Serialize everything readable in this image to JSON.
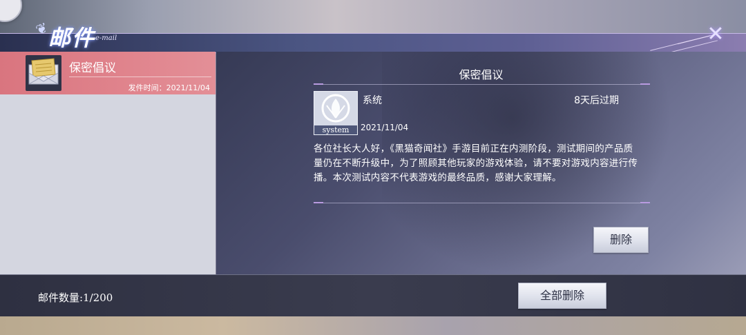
{
  "header": {
    "title": "邮件",
    "subtitle": "e-mail",
    "close_icon": "close-icon"
  },
  "mail_list": {
    "items": [
      {
        "title": "保密倡议",
        "date_text": "发件时间：2021/11/04",
        "icon": "envelope-icon",
        "selected": true
      }
    ]
  },
  "detail": {
    "title": "保密倡议",
    "sender": "系统",
    "avatar_label": "system",
    "expire": "8天后过期",
    "date": "2021/11/04",
    "body": "各位社长大人好，《黑猫奇闻社》手游目前正在内测阶段，测试期间的产品质量仍在不断升级中，为了照顾其他玩家的游戏体验，请不要对游戏内容进行传播。本次测试内容不代表游戏的最终品质，感谢大家理解。",
    "delete_label": "删除"
  },
  "footer": {
    "count_text": "邮件数量:1/200",
    "delete_all_label": "全部删除"
  },
  "colors": {
    "selected_item": "#d9757f",
    "header": "#4b5582",
    "footer": "#2e3041"
  }
}
